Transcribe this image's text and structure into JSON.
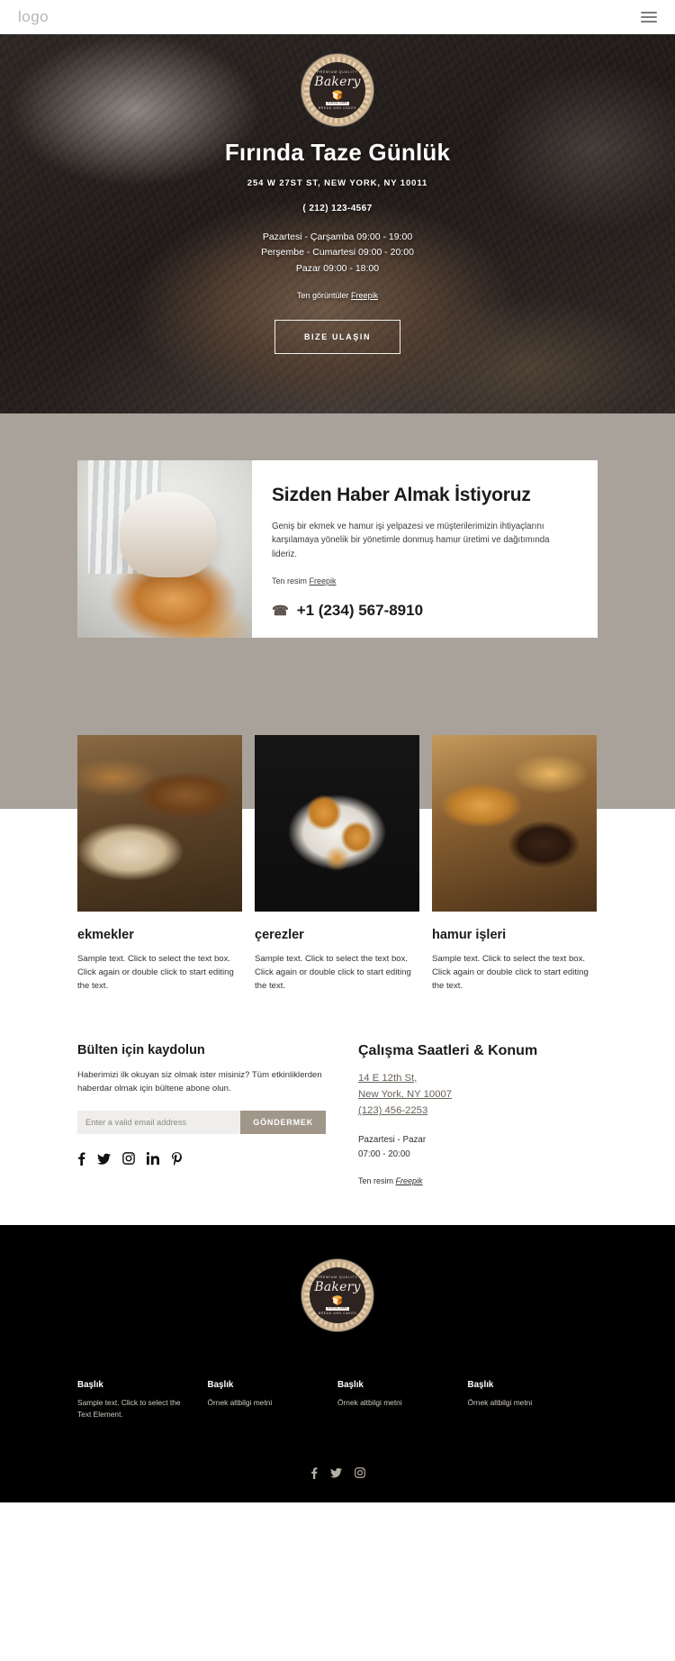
{
  "header": {
    "logo": "logo",
    "menu_icon": "hamburger-icon"
  },
  "hero": {
    "badge": {
      "top_text": "PREMIUM QUALITY",
      "name": "Bakery",
      "since": "SINCE 1988",
      "bottom_text": "BREAD AND CAKES"
    },
    "title": "Fırında Taze Günlük",
    "address": "254 W 27ST ST, NEW YORK, NY 10011",
    "phone": "( 212) 123-4567",
    "hours": [
      "Pazartesi - Çarşamba 09:00 - 19:00",
      "Perşembe - Cumartesi 09:00 - 20:00",
      "Pazar 09:00 - 18:00"
    ],
    "credit_prefix": "Ten görüntüler ",
    "credit_link": "Freepik",
    "cta_label": "BIZE ULAŞIN"
  },
  "about": {
    "title": "Sizden Haber Almak İstiyoruz",
    "description": "Geniş bir ekmek ve hamur işi yelpazesi ve müşterilerimizin ihtiyaçlarını karşılamaya yönelik bir yönetimle donmuş hamur üretimi ve dağıtımında lideriz.",
    "credit_prefix": "Ten resim ",
    "credit_link": "Freepik",
    "phone": "+1 (234) 567-8910",
    "phone_icon": "phone-icon",
    "image_alt": "baker-holding-tray"
  },
  "cards": [
    {
      "title": "ekmekler",
      "text": "Sample text. Click to select the text box. Click again or double click to start editing the text.",
      "image": "bread-loaves-photo"
    },
    {
      "title": "çerezler",
      "text": "Sample text. Click to select the text box. Click again or double click to start editing the text.",
      "image": "cinnamon-buns-photo"
    },
    {
      "title": "hamur işleri",
      "text": "Sample text. Click to select the text box. Click again or double click to start editing the text.",
      "image": "pastries-photo"
    }
  ],
  "newsletter": {
    "title": "Bülten için kaydolun",
    "description": "Haberimizi ilk okuyan siz olmak ister misiniz? Tüm etkinliklerden haberdar olmak için bültene abone olun.",
    "input_placeholder": "Enter a valid email address",
    "input_value": "",
    "submit_label": "GÖNDERMEK",
    "socials": [
      "facebook-icon",
      "twitter-icon",
      "instagram-icon",
      "linkedin-icon",
      "pinterest-icon"
    ]
  },
  "hours_location": {
    "title": "Çalışma Saatleri & Konum",
    "address_line1": "14 E 12th St,",
    "address_line2": "New York, NY 10007",
    "phone": "(123) 456-2253",
    "days": "Pazartesi - Pazar",
    "time": "07:00 - 20:00",
    "credit_prefix": "Ten resim ",
    "credit_link": "Freepik"
  },
  "footer": {
    "badge": {
      "top_text": "PREMIUM QUALITY",
      "name": "Bakery",
      "since": "SINCE 1988",
      "bottom_text": "BREAD AND CAKES"
    },
    "columns": [
      {
        "title": "Başlık",
        "text": "Sample text. Click to select the Text Element."
      },
      {
        "title": "Başlık",
        "text": "Örnek altbilgi metni"
      },
      {
        "title": "Başlık",
        "text": "Örnek altbilgi metni"
      },
      {
        "title": "Başlık",
        "text": "Örnek altbilgi metni"
      }
    ],
    "socials": [
      "facebook-icon",
      "twitter-icon",
      "instagram-icon"
    ]
  },
  "colors": {
    "taupe": "#a9a29a",
    "accent": "#a09689",
    "footer_bg": "#000000",
    "link": "#6a635b"
  }
}
